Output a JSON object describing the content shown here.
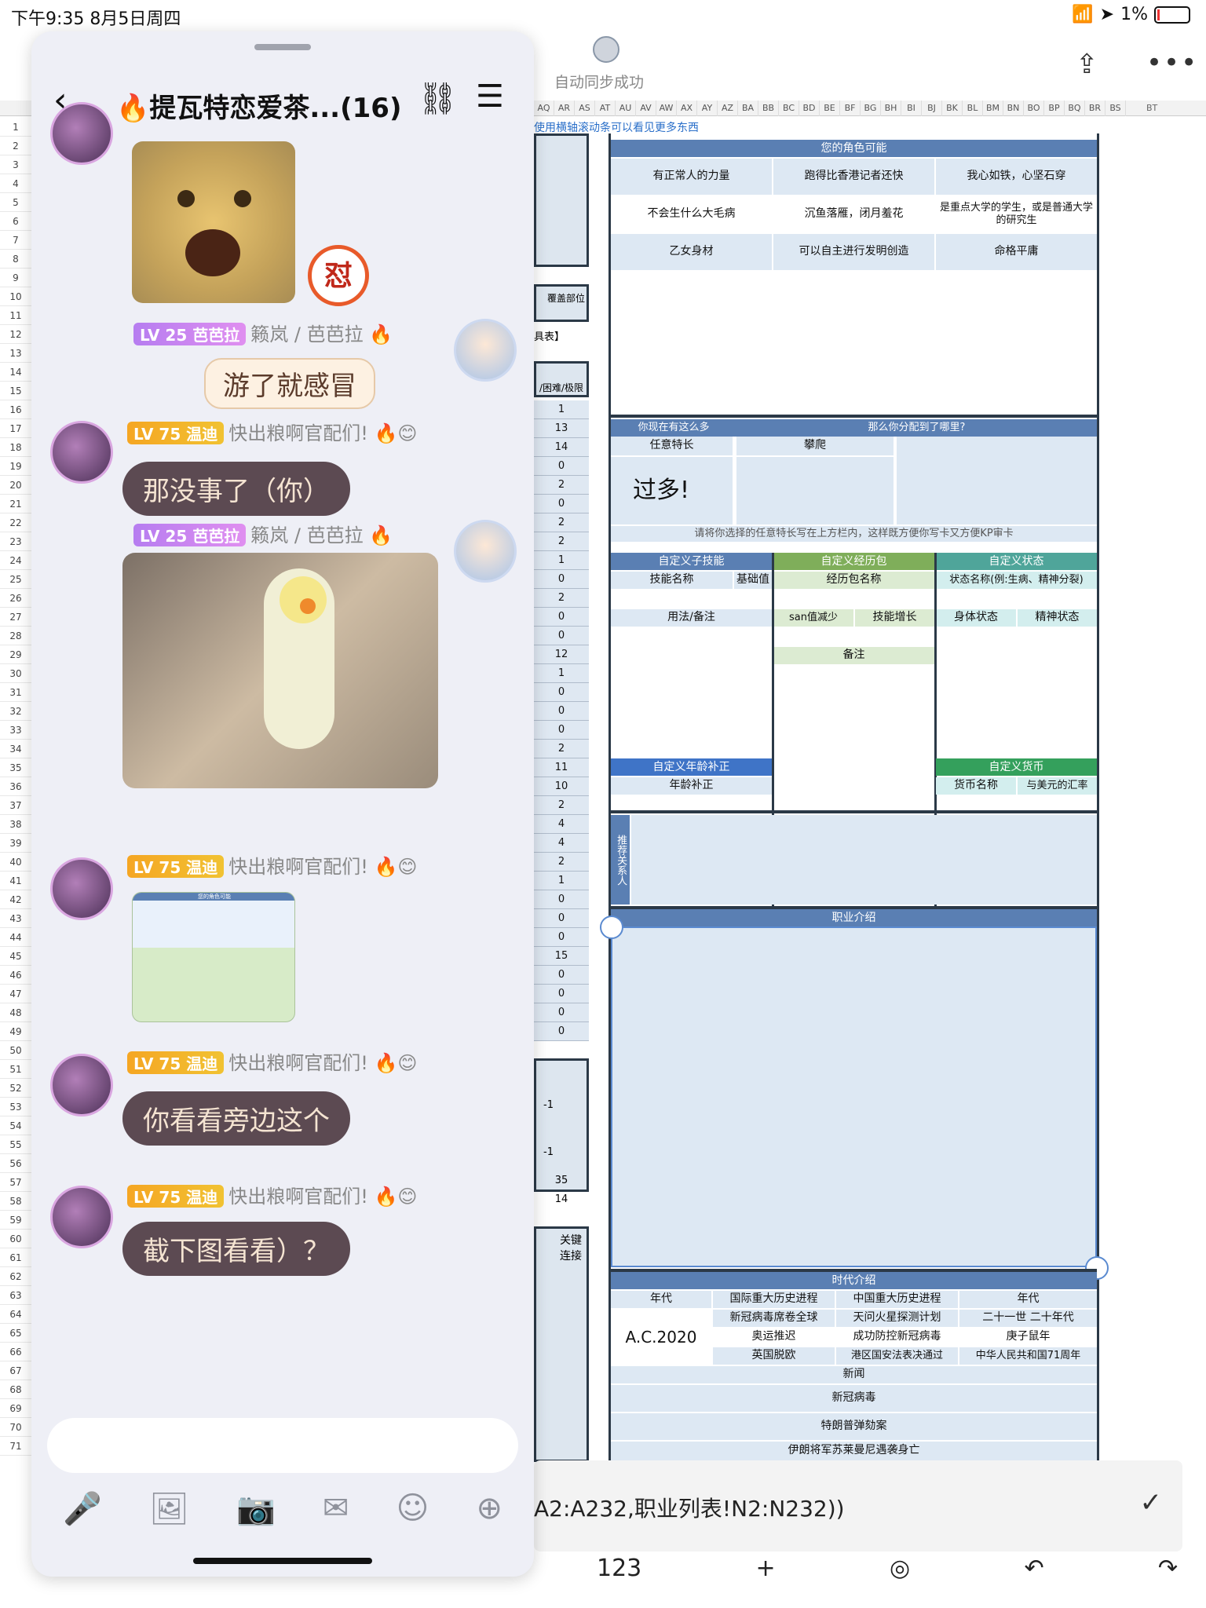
{
  "status": {
    "time": "下午9:35   8月5日周四",
    "battery": "1%"
  },
  "sheet": {
    "sync_text": "自动同步成功",
    "columns": [
      "AQ",
      "AR",
      "AS",
      "AT",
      "AU",
      "AV",
      "AW",
      "AX",
      "AY",
      "AZ",
      "BA",
      "BB",
      "BC",
      "BD",
      "BE",
      "BF",
      "BG",
      "BH",
      "BI",
      "BJ",
      "BK",
      "BL",
      "BM",
      "BN",
      "BO",
      "BP",
      "BQ",
      "BR",
      "BS"
    ],
    "bt": "BT",
    "hint": "使用横轴滚动条可以看见更多东西",
    "row_numbers": [
      "1",
      "2",
      "3",
      "4",
      "5",
      "6",
      "7",
      "8",
      "9",
      "10",
      "11",
      "12",
      "13",
      "14",
      "15",
      "16",
      "17",
      "18",
      "19",
      "20",
      "21",
      "22",
      "23",
      "24",
      "25",
      "26",
      "27",
      "28",
      "29",
      "30",
      "31",
      "32",
      "33",
      "34",
      "35",
      "36",
      "37",
      "38",
      "39",
      "40",
      "41",
      "42",
      "43",
      "44",
      "45",
      "46",
      "47",
      "48",
      "49",
      "50",
      "51",
      "52",
      "53",
      "54",
      "55",
      "56",
      "57",
      "58",
      "59",
      "60",
      "61",
      "62",
      "63",
      "64",
      "65",
      "66",
      "67",
      "68",
      "69",
      "70",
      "71"
    ],
    "partial": {
      "cover": "覆盖部位",
      "tool": "具表】",
      "hard": "/困难/极限",
      "key": "关键\n连接"
    },
    "num_values": [
      "1",
      "13",
      "14",
      "0",
      "2",
      "0",
      "2",
      "2",
      "1",
      "0",
      "2",
      "0",
      "0",
      "12",
      "1",
      "0",
      "0",
      "0",
      "2",
      "11",
      "10",
      "2",
      "4",
      "4",
      "2",
      "1",
      "0",
      "0",
      "0",
      "15",
      "0",
      "0",
      "0",
      "0"
    ],
    "low_values": [
      "-1",
      "-1",
      "35",
      "14"
    ],
    "roles": {
      "head": "您的角色可能",
      "items": [
        "有正常人的力量",
        "跑得比香港记者还快",
        "我心如铁，心坚石穿",
        "不会生什么大毛病",
        "沉鱼落雁，闭月羞花",
        "是重点大学的学生，或是普通大学的研究生",
        "乙女身材",
        "可以自主进行发明创造",
        "命格平庸"
      ]
    },
    "skills": {
      "head_left": "你现在有这么多",
      "head_right": "那么你分配到了哪里?",
      "any": "任意特长",
      "climb": "攀爬",
      "too_many": "过多!",
      "note": "请将你选择的任意特长写在上方栏内，这样既方便你写卡又方便KP审卡"
    },
    "custom_skill": {
      "head": "自定义子技能",
      "name": "技能名称",
      "base": "基础值",
      "usage": "用法/备注"
    },
    "custom_pack": {
      "head": "自定义经历包",
      "name": "经历包名称",
      "san": "san值减少",
      "growth": "技能增长",
      "remark": "备注"
    },
    "custom_state": {
      "head": "自定义状态",
      "name": "状态名称(例:生病、精神分裂)",
      "body": "身体状态",
      "mind": "精神状态"
    },
    "age": {
      "head": "自定义年龄补正",
      "label": "年龄补正"
    },
    "currency": {
      "head": "自定义货币",
      "name": "货币名称",
      "rate": "与美元的汇率"
    },
    "relation": "推荐关系人",
    "job": "职业介绍",
    "era": {
      "head": "时代介绍",
      "cols": [
        "年代",
        "国际重大历史进程",
        "中国重大历史进程",
        "年代"
      ],
      "year": "A.C.2020",
      "intl": [
        "新冠病毒席卷全球",
        "奥运推迟",
        "英国脱欧"
      ],
      "china": [
        "天问火星探测计划",
        "成功防控新冠病毒",
        "港区国安法表决通过"
      ],
      "era_right": [
        "二十一世 二十年代",
        "庚子鼠年",
        "中华人民共和国71周年"
      ],
      "news_head": "新闻",
      "news": [
        "新冠病毒",
        "特朗普弹劾案",
        "伊朗将军苏莱曼尼遇袭身亡"
      ]
    },
    "formula": "A2:A232,职业列表!N2:N232))",
    "toolbar": [
      "123",
      "+",
      "◎",
      "↶",
      "↷"
    ]
  },
  "chat": {
    "title": "提瓦特恋爱茶...(16)",
    "messages": [
      {
        "who": "芭芭拉",
        "level": "LV 25",
        "nick": "芭芭拉",
        "name": "籁岚 / 芭芭拉",
        "sticker_text": "游了就感冒"
      },
      {
        "who": "温迪",
        "level": "LV 75",
        "nick": "温迪",
        "name": "快出粮啊官配们!",
        "text": "那没事了（你）"
      },
      {
        "who": "芭芭拉",
        "level": "LV 25",
        "nick": "芭芭拉",
        "name": "籁岚 / 芭芭拉"
      },
      {
        "who": "温迪",
        "level": "LV 75",
        "nick": "温迪",
        "name": "快出粮啊官配们!"
      },
      {
        "who": "温迪",
        "level": "LV 75",
        "nick": "温迪",
        "name": "快出粮啊官配们!",
        "text": "你看看旁边这个"
      },
      {
        "who": "温迪",
        "level": "LV 75",
        "nick": "温迪",
        "name": "快出粮啊官配们!",
        "text": "截下图看看）？"
      }
    ],
    "badge": "怼",
    "mini_sheet_title": "您的角色可能"
  }
}
